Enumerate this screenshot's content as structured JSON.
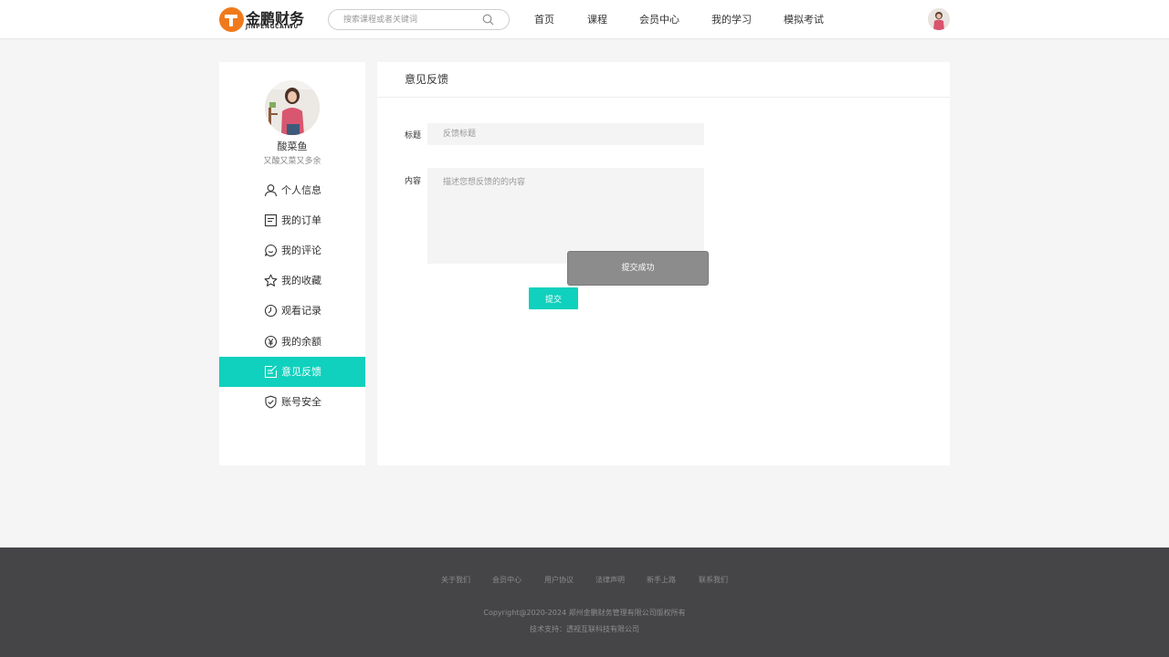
{
  "header": {
    "logo_cn": "金鹏财务",
    "logo_en": "JINPENGCAIWU",
    "search_placeholder": "搜索课程或者关键词",
    "nav": [
      "首页",
      "课程",
      "会员中心",
      "我的学习",
      "模拟考试"
    ]
  },
  "sidebar": {
    "name": "酸菜鱼",
    "signature": "又酸又菜又多余",
    "items": [
      {
        "label": "个人信息",
        "icon": "user-icon"
      },
      {
        "label": "我的订单",
        "icon": "order-icon"
      },
      {
        "label": "我的评论",
        "icon": "comment-icon"
      },
      {
        "label": "我的收藏",
        "icon": "star-icon"
      },
      {
        "label": "观看记录",
        "icon": "clock-icon"
      },
      {
        "label": "我的余额",
        "icon": "yen-icon"
      },
      {
        "label": "意见反馈",
        "icon": "edit-icon"
      },
      {
        "label": "账号安全",
        "icon": "shield-icon"
      }
    ],
    "active_index": 6
  },
  "main": {
    "title": "意见反馈",
    "title_label": "标题",
    "title_placeholder": "反馈标题",
    "content_label": "内容",
    "content_placeholder": "描述您想反馈的的内容",
    "toast": "提交成功",
    "submit": "提交"
  },
  "footer": {
    "links": [
      "关于我们",
      "会员中心",
      "用户协议",
      "法律声明",
      "新手上路",
      "联系我们"
    ],
    "copyright": "Copyright@2020-2024 郑州金鹏财务管理有限公司版权所有",
    "support": "技术支持：透视互联科技有限公司"
  },
  "colors": {
    "accent": "#0fd1bd",
    "logo": "#f07a1b",
    "footer_bg": "#454547"
  }
}
